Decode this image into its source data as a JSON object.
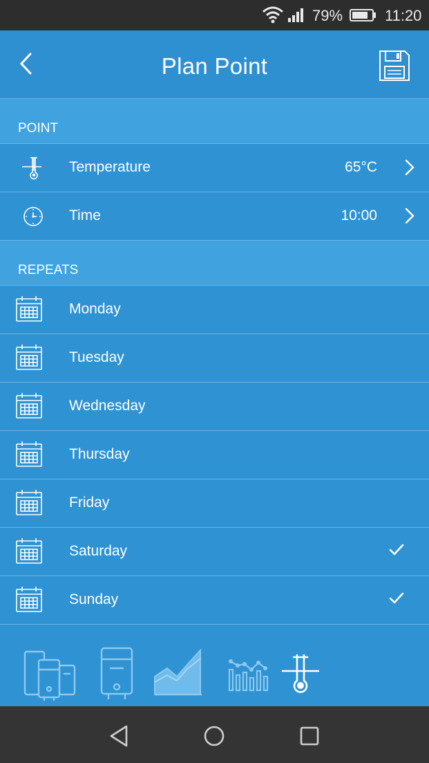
{
  "status_bar": {
    "battery": "79%",
    "time": "11:20"
  },
  "header": {
    "title": "Plan Point"
  },
  "point_section": {
    "heading": "POINT",
    "rows": [
      {
        "label": "Temperature",
        "value": "65°C",
        "icon": "thermometer-icon"
      },
      {
        "label": "Time",
        "value": "10:00",
        "icon": "clock-icon"
      }
    ]
  },
  "repeats_section": {
    "heading": "REPEATS",
    "days": [
      {
        "label": "Monday",
        "checked": false
      },
      {
        "label": "Tuesday",
        "checked": false
      },
      {
        "label": "Wednesday",
        "checked": false
      },
      {
        "label": "Thursday",
        "checked": false
      },
      {
        "label": "Friday",
        "checked": false
      },
      {
        "label": "Saturday",
        "checked": true
      },
      {
        "label": "Sunday",
        "checked": true
      }
    ]
  },
  "bottom_nav": {
    "items": [
      "multi-heater-icon",
      "water-heater-icon",
      "area-chart-icon",
      "bar-line-chart-icon",
      "thermometer-icon"
    ],
    "active": "thermometer-icon"
  },
  "colors": {
    "background": "#2e92d3",
    "section": "#40a2df",
    "status_bar": "#2d2d2d",
    "nav_bar": "#343434"
  }
}
